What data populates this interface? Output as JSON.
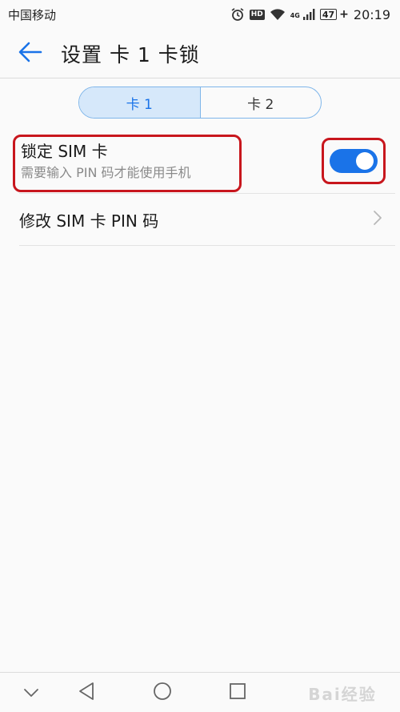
{
  "status_bar": {
    "carrier": "中国移动",
    "hd": "HD",
    "signal_label": "4G",
    "battery": "47",
    "time": "20:19"
  },
  "header": {
    "title": "设置 卡 1 卡锁"
  },
  "tabs": [
    {
      "label": "卡 1",
      "active": true
    },
    {
      "label": "卡 2",
      "active": false
    }
  ],
  "lock_sim": {
    "title": "锁定 SIM 卡",
    "subtitle": "需要输入 PIN 码才能使用手机",
    "enabled": true
  },
  "change_pin": {
    "title": "修改 SIM 卡 PIN 码"
  },
  "watermark": "Bai经验",
  "colors": {
    "accent": "#1a73e8",
    "highlight": "#c8161d",
    "tab_active_bg": "#d6e8fa"
  },
  "icons": {
    "back": "arrow-left-icon",
    "chevron": "chevron-right-icon",
    "nav": [
      "chevron-down-icon",
      "back-triangle-icon",
      "home-circle-icon",
      "recents-square-icon"
    ]
  }
}
